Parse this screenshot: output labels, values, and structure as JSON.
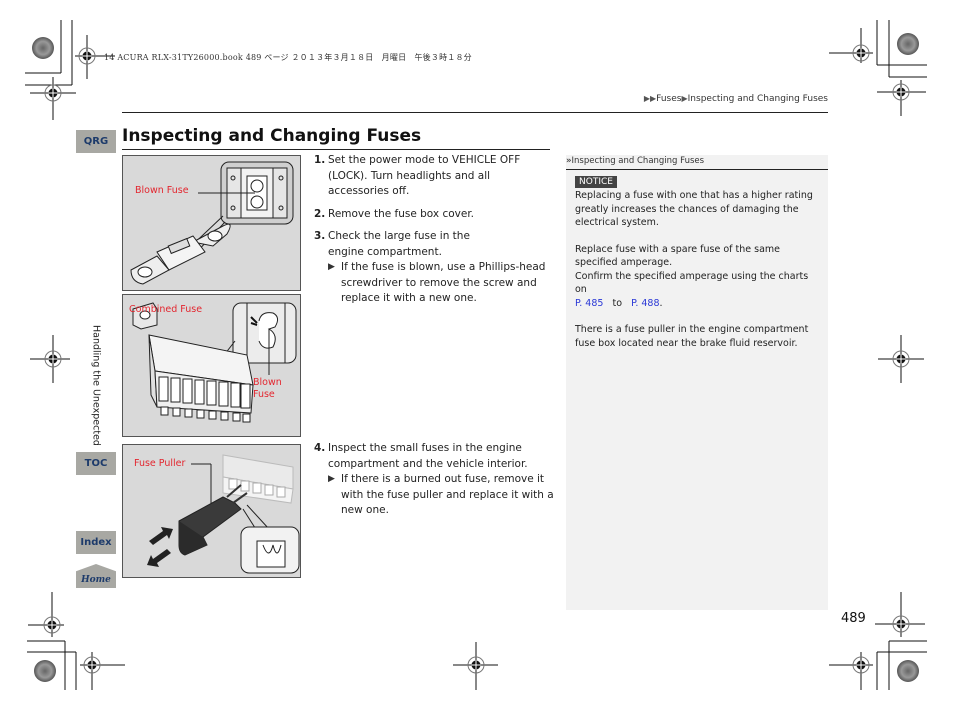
{
  "print_header": "14 ACURA RLX-31TY26000.book  489 ページ  ２０１３年３月１８日　月曜日　午後３時１８分",
  "breadcrumb": {
    "prefix_icon": "double-triangle-icon",
    "items": [
      "Fuses",
      "Inspecting and Changing Fuses"
    ]
  },
  "page_title": "Inspecting and Changing Fuses",
  "side_nav": {
    "qrg": "QRG",
    "section": "Handling the Unexpected",
    "toc": "TOC",
    "index": "Index",
    "home": "Home"
  },
  "figures": [
    {
      "caption": "Blown Fuse",
      "subject": "large fuse with magnified blown element"
    },
    {
      "caption": "Combined Fuse",
      "callout": [
        "Blown",
        "Fuse"
      ],
      "subject": "combined fuse block with magnified blown element"
    },
    {
      "caption": "Fuse Puller",
      "subject": "fuse puller removing small fuse"
    }
  ],
  "steps": [
    {
      "num": "1.",
      "lines": [
        "Set the power mode to VEHICLE OFF",
        "(LOCK). Turn headlights and all",
        "accessories  off."
      ],
      "sub": null
    },
    {
      "num": "2.",
      "lines": [
        "Remove the fuse box cover."
      ],
      "sub": null
    },
    {
      "num": "3.",
      "lines": [
        "Check the large fuse in the",
        "engine compartment."
      ],
      "sub": [
        "If the fuse is blown, use a Phillips-head",
        "screwdriver to remove the screw and",
        "replace it with a new one."
      ]
    },
    {
      "num": "4.",
      "lines": [
        "Inspect the small fuses in the engine",
        "compartment and the vehicle interior."
      ],
      "sub": [
        "If there is a burned out fuse, remove it",
        "with the fuse puller and replace it with a",
        "new one."
      ]
    }
  ],
  "sidebar": {
    "heading": "Inspecting and Changing Fuses",
    "notice_label": "NOTICE",
    "notice_text": "Replacing a fuse with one that has a higher rating greatly increases the chances of damaging the electrical system.",
    "replace_text": "Replace fuse with a spare fuse of the same specified amperage.",
    "confirm_text": "Confirm the specified amperage using the charts on",
    "link_from": "P. 485",
    "to_word": "to",
    "link_to": "P. 488",
    "period": ".",
    "puller_text": "There is a fuse puller in the engine compartment fuse box located near the brake fluid reservoir."
  },
  "page_number": "489",
  "colors": {
    "nav_button_bg": "#a8a8a3",
    "nav_button_text": "#1d3b6b",
    "figure_label": "#e3262f",
    "link": "#2a38d6",
    "sidebar_bg": "#f2f2f2",
    "notice_bg": "#444444"
  }
}
